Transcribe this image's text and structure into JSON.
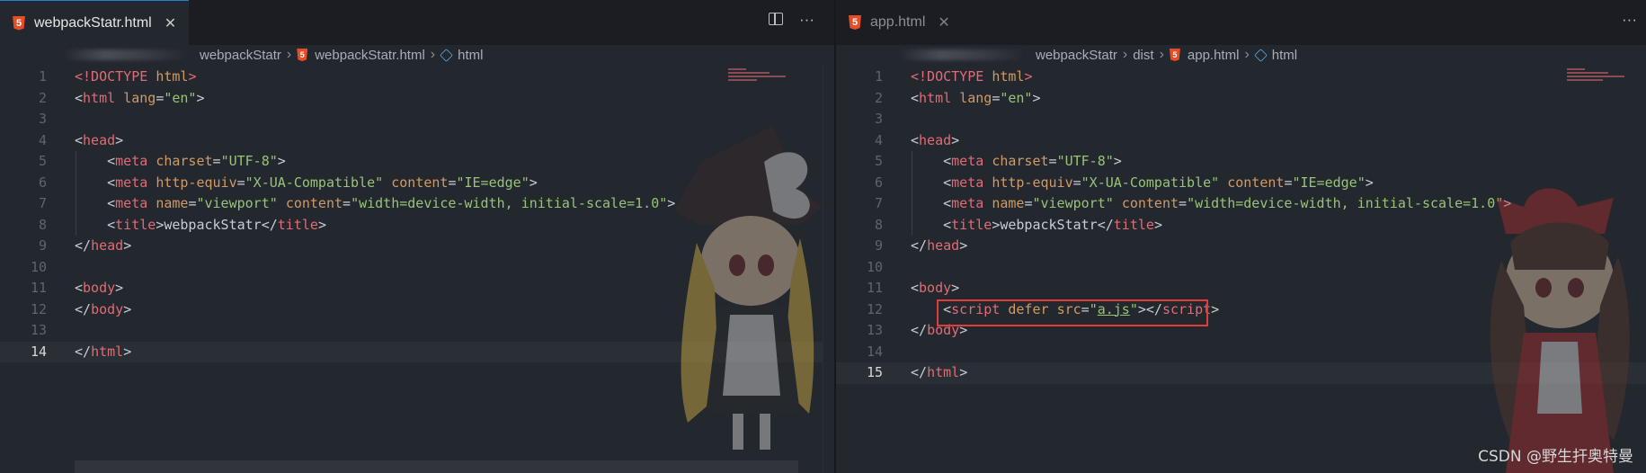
{
  "left": {
    "tab": {
      "label": "webpackStatr.html",
      "close": "✕"
    },
    "tab_actions": {
      "more": "···"
    },
    "breadcrumb": {
      "folder": "webpackStatr",
      "file": "webpackStatr.html",
      "symbol": "html"
    },
    "lines": [
      {
        "n": "1",
        "html": "<span class='tag'>&lt;!DOCTYPE</span> <span class='attr'>html</span><span class='tag'>&gt;</span>"
      },
      {
        "n": "2",
        "html": "<span class='punct'>&lt;</span><span class='tag'>html</span> <span class='attr'>lang</span><span class='punct'>=</span><span class='str'>\"en\"</span><span class='punct'>&gt;</span>"
      },
      {
        "n": "3",
        "html": ""
      },
      {
        "n": "4",
        "html": "<span class='punct'>&lt;</span><span class='tag'>head</span><span class='punct'>&gt;</span>"
      },
      {
        "n": "5",
        "html": "    <span class='punct'>&lt;</span><span class='tag'>meta</span> <span class='attr'>charset</span><span class='punct'>=</span><span class='str'>\"UTF-8\"</span><span class='punct'>&gt;</span>"
      },
      {
        "n": "6",
        "html": "    <span class='punct'>&lt;</span><span class='tag'>meta</span> <span class='attr'>http-equiv</span><span class='punct'>=</span><span class='str'>\"X-UA-Compatible\"</span> <span class='attr'>content</span><span class='punct'>=</span><span class='str'>\"IE=edge\"</span><span class='punct'>&gt;</span>"
      },
      {
        "n": "7",
        "html": "    <span class='punct'>&lt;</span><span class='tag'>meta</span> <span class='attr'>name</span><span class='punct'>=</span><span class='str'>\"viewport\"</span> <span class='attr'>content</span><span class='punct'>=</span><span class='str'>\"width=device-width, initial-scale=1.0\"</span><span class='punct'>&gt;</span>"
      },
      {
        "n": "8",
        "html": "    <span class='punct'>&lt;</span><span class='tag'>title</span><span class='punct'>&gt;</span><span class='txt'>webpackStatr</span><span class='punct'>&lt;/</span><span class='tag'>title</span><span class='punct'>&gt;</span>"
      },
      {
        "n": "9",
        "html": "<span class='punct'>&lt;/</span><span class='tag'>head</span><span class='punct'>&gt;</span>"
      },
      {
        "n": "10",
        "html": ""
      },
      {
        "n": "11",
        "html": "<span class='punct'>&lt;</span><span class='tag'>body</span><span class='punct'>&gt;</span>"
      },
      {
        "n": "12",
        "html": "<span class='punct'>&lt;/</span><span class='tag'>body</span><span class='punct'>&gt;</span>"
      },
      {
        "n": "13",
        "html": ""
      },
      {
        "n": "14",
        "html": "<span class='punct'>&lt;/</span><span class='tag'>html</span><span class='punct'>&gt;</span>",
        "current": true
      }
    ]
  },
  "right": {
    "tab": {
      "label": "app.html",
      "close": "✕"
    },
    "tab_actions": {
      "more": "···"
    },
    "breadcrumb": {
      "folder": "webpackStatr",
      "subfolder": "dist",
      "file": "app.html",
      "symbol": "html"
    },
    "lines": [
      {
        "n": "1",
        "html": "<span class='tag'>&lt;!DOCTYPE</span> <span class='attr'>html</span><span class='tag'>&gt;</span>"
      },
      {
        "n": "2",
        "html": "<span class='punct'>&lt;</span><span class='tag'>html</span> <span class='attr'>lang</span><span class='punct'>=</span><span class='str'>\"en\"</span><span class='punct'>&gt;</span>"
      },
      {
        "n": "3",
        "html": ""
      },
      {
        "n": "4",
        "html": "<span class='punct'>&lt;</span><span class='tag'>head</span><span class='punct'>&gt;</span>"
      },
      {
        "n": "5",
        "html": "    <span class='punct'>&lt;</span><span class='tag'>meta</span> <span class='attr'>charset</span><span class='punct'>=</span><span class='str'>\"UTF-8\"</span><span class='punct'>&gt;</span>"
      },
      {
        "n": "6",
        "html": "    <span class='punct'>&lt;</span><span class='tag'>meta</span> <span class='attr'>http-equiv</span><span class='punct'>=</span><span class='str'>\"X-UA-Compatible\"</span> <span class='attr'>content</span><span class='punct'>=</span><span class='str'>\"IE=edge\"</span><span class='punct'>&gt;</span>"
      },
      {
        "n": "7",
        "html": "    <span class='punct'>&lt;</span><span class='tag'>meta</span> <span class='attr'>name</span><span class='punct'>=</span><span class='str'>\"viewport\"</span> <span class='attr'>content</span><span class='punct'>=</span><span class='str'>\"width=device-width, initial-scale=1.0\"</span><span class='punct'>&gt;</span>"
      },
      {
        "n": "8",
        "html": "    <span class='punct'>&lt;</span><span class='tag'>title</span><span class='punct'>&gt;</span><span class='txt'>webpackStatr</span><span class='punct'>&lt;/</span><span class='tag'>title</span><span class='punct'>&gt;</span>"
      },
      {
        "n": "9",
        "html": "<span class='punct'>&lt;/</span><span class='tag'>head</span><span class='punct'>&gt;</span>"
      },
      {
        "n": "10",
        "html": ""
      },
      {
        "n": "11",
        "html": "<span class='punct'>&lt;</span><span class='tag'>body</span><span class='punct'>&gt;</span>"
      },
      {
        "n": "12",
        "html": "    <span class='punct'>&lt;</span><span class='tag'>script</span> <span class='attr'>defer</span> <span class='attr'>src</span><span class='punct'>=</span><span class='str'>\"<u>a.js</u>\"</span><span class='punct'>&gt;&lt;/</span><span class='tag'>script</span><span class='punct'>&gt;</span>"
      },
      {
        "n": "13",
        "html": "<span class='punct'>&lt;/</span><span class='tag'>body</span><span class='punct'>&gt;</span>"
      },
      {
        "n": "14",
        "html": ""
      },
      {
        "n": "15",
        "html": "<span class='punct'>&lt;/</span><span class='tag'>html</span><span class='punct'>&gt;</span>",
        "current": true
      }
    ]
  },
  "watermark": "CSDN @野生扞奥特曼",
  "colors": {
    "tag": "#e06c75",
    "attr": "#d19a66",
    "string": "#98c379",
    "highlight_border": "#e23b3b",
    "html5": "#e44d26",
    "active_tab_border": "#2b79d6"
  }
}
